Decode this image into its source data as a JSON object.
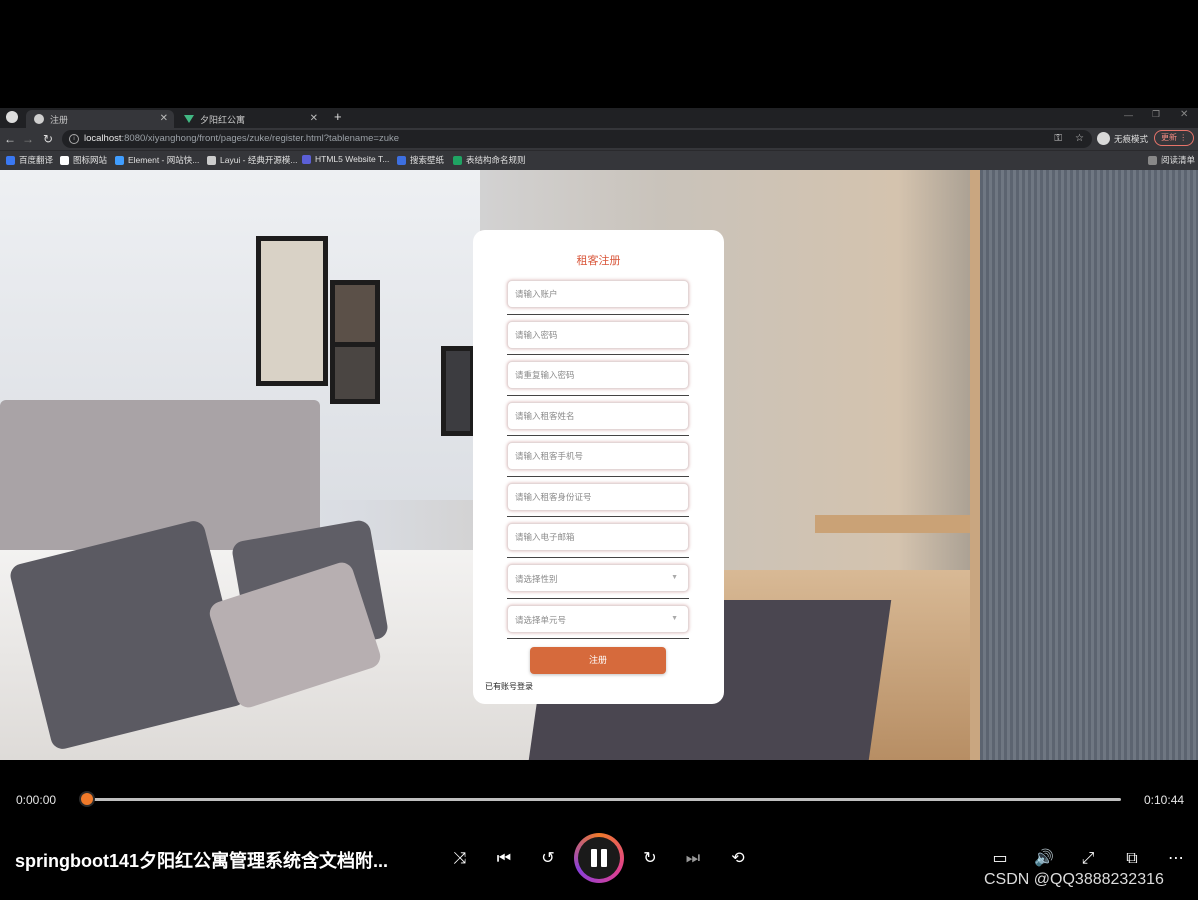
{
  "browser": {
    "tabs": [
      {
        "label": "注册",
        "active": true
      },
      {
        "label": "夕阳红公寓",
        "active": false
      }
    ],
    "new_tab": "+",
    "url_host": "localhost",
    "url_path": ":8080/xiyanghong/front/pages/zuke/register.html?tablename=zuke",
    "profile_label": "无痕模式",
    "update_label": "更新",
    "bookmarks": [
      "百度翻译",
      "图标网站",
      "Element - 网站快...",
      "Layui - 经典开源模...",
      "HTML5 Website T...",
      "搜索壁纸",
      "表结构命名规则"
    ],
    "reading_list": "阅读清单"
  },
  "form": {
    "title": "租客注册",
    "fields": [
      {
        "placeholder": "请输入账户"
      },
      {
        "placeholder": "请输入密码"
      },
      {
        "placeholder": "请重复输入密码"
      },
      {
        "placeholder": "请输入租客姓名"
      },
      {
        "placeholder": "请输入租客手机号"
      },
      {
        "placeholder": "请输入租客身份证号"
      },
      {
        "placeholder": "请输入电子邮箱"
      }
    ],
    "selects": [
      {
        "placeholder": "请选择性别"
      },
      {
        "placeholder": "请选择单元号"
      }
    ],
    "register_button": "注册",
    "login_link": "已有账号登录"
  },
  "player": {
    "current_time": "0:00:00",
    "duration": "0:10:44",
    "progress": 0.0,
    "title": "springboot141夕阳红公寓管理系统含文档附...",
    "watermark": "CSDN @QQ3888232316",
    "icons": [
      "shuffle-icon",
      "previous-icon",
      "rewind-10-icon",
      "pause-icon",
      "forward-30-icon",
      "next-icon",
      "repeat-icon",
      "subtitles-icon",
      "volume-icon",
      "fullscreen-icon",
      "miniplayer-icon",
      "more-icon"
    ],
    "accent": "#f07a2a"
  },
  "colors": {
    "form_title": "#d9573b",
    "button": "#d66a3c"
  }
}
